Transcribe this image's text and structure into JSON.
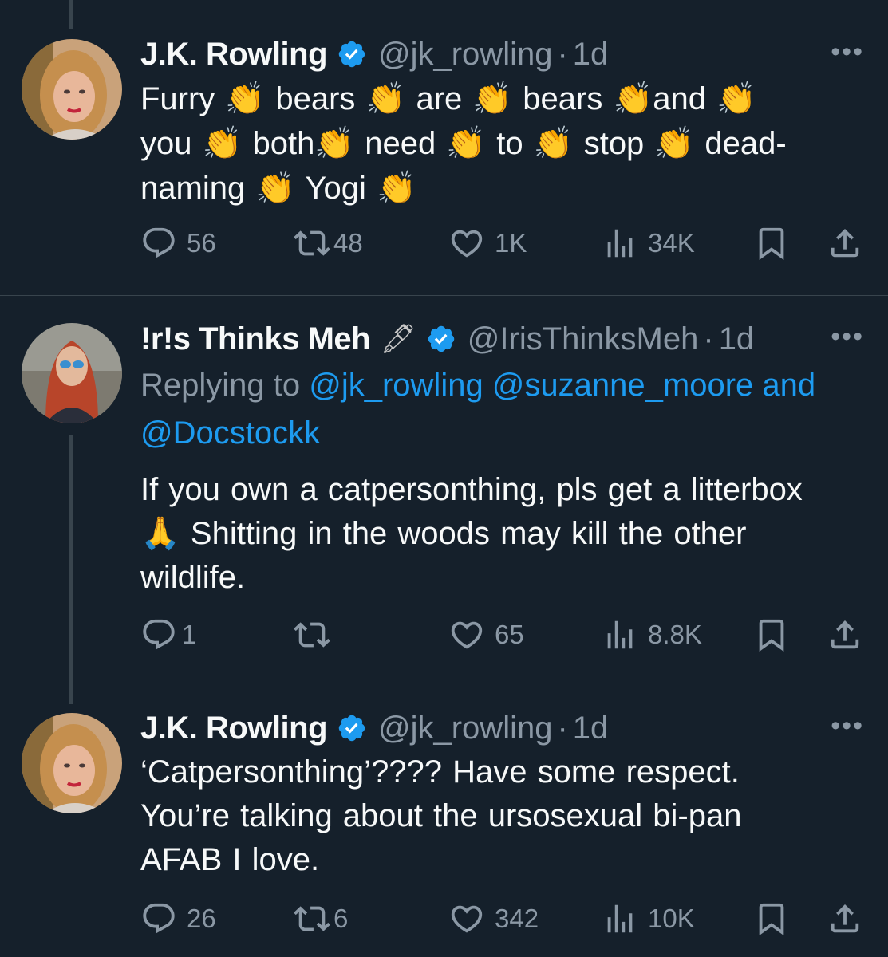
{
  "tweets": [
    {
      "name": "J.K. Rowling",
      "handle": "@jk_rowling",
      "dot": "·",
      "time": "1d",
      "more": "•••",
      "lines": [
        "Furry 👏 bears 👏 are 👏 bears 👏and 👏",
        "you 👏 both👏 need 👏 to 👏 stop 👏 dead-",
        "naming 👏 Yogi 👏"
      ],
      "actions": {
        "replies": "56",
        "retweets": "48",
        "likes": "1K",
        "views": "34K"
      }
    },
    {
      "name": "!r!s Thinks Meh",
      "pen": "🖋",
      "handle": "@IrisThinksMeh",
      "dot": "·",
      "time": "1d",
      "more": "•••",
      "replying_prefix": "Replying to ",
      "replying_links": "@jk_rowling @suzanne_moore and",
      "replying_link2": "@Docstockk",
      "lines": [
        "If you own a catpersonthing, pls get a litterbox",
        "🙏 Shitting in the woods may kill the other",
        "wildlife."
      ],
      "actions": {
        "replies": "1",
        "retweets": "",
        "likes": "65",
        "views": "8.8K"
      }
    },
    {
      "name": "J.K. Rowling",
      "handle": "@jk_rowling",
      "dot": "·",
      "time": "1d",
      "more": "•••",
      "lines": [
        "‘Catpersonthing’???? Have some respect.",
        "You’re talking about the ursosexual bi-pan",
        "AFAB I love."
      ],
      "actions": {
        "replies": "26",
        "retweets": "6",
        "likes": "342",
        "views": "10K"
      }
    }
  ],
  "colors": {
    "background": "#15202b",
    "text": "#f7f9f9",
    "muted": "#8b98a5",
    "link": "#1d9bf0",
    "verified": "#1d9bf0",
    "divider": "#38444d"
  }
}
